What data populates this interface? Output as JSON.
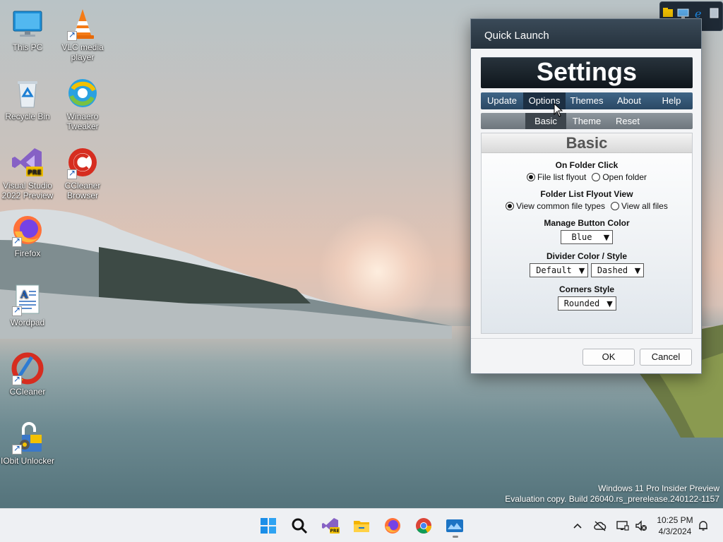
{
  "desktop": {
    "icons": [
      {
        "label": "This PC",
        "icon": "computer-icon"
      },
      {
        "label": "VLC media player",
        "icon": "vlc-cone-icon"
      },
      {
        "label": "Recycle Bin",
        "icon": "recycle-bin-icon"
      },
      {
        "label": "Winaero Tweaker",
        "icon": "winaero-tweaker-icon"
      },
      {
        "label": "Visual Studio 2022 Preview",
        "icon": "visual-studio-icon",
        "badge": "PRE"
      },
      {
        "label": "CCleaner Browser",
        "icon": "ccleaner-browser-icon"
      },
      {
        "label": "Firefox",
        "icon": "firefox-icon"
      },
      {
        "label": "Wordpad",
        "icon": "wordpad-icon"
      },
      {
        "label": "CCleaner",
        "icon": "ccleaner-icon"
      },
      {
        "label": "IObit Unlocker",
        "icon": "iobit-unlocker-icon"
      }
    ]
  },
  "watermark": {
    "line1": "Windows 11 Pro Insider Preview",
    "line2": "Evaluation copy. Build 26040.rs_prerelease.240122-1157"
  },
  "dialog": {
    "title": "Quick Launch",
    "banner": "Settings",
    "tabs": [
      "Update",
      "Options",
      "Themes",
      "About",
      "Help"
    ],
    "active_tab": "Options",
    "subtabs": [
      "Basic",
      "Theme",
      "Reset"
    ],
    "active_subtab": "Basic",
    "panel_title": "Basic",
    "on_folder_click": {
      "title": "On Folder Click",
      "options": [
        "File list flyout",
        "Open folder"
      ],
      "selected": "File list flyout"
    },
    "folder_list_view": {
      "title": "Folder List Flyout View",
      "options": [
        "View common file types",
        "View all files"
      ],
      "selected": "View common file types"
    },
    "manage_button_color": {
      "title": "Manage Button Color",
      "value": "Blue"
    },
    "divider": {
      "title": "Divider Color / Style",
      "color_value": "Default",
      "style_value": "Dashed"
    },
    "corners": {
      "title": "Corners Style",
      "value": "Rounded"
    },
    "ok_label": "OK",
    "cancel_label": "Cancel"
  },
  "taskbar": {
    "apps": [
      "windows-start-icon",
      "search-icon",
      "visual-studio-preview-icon",
      "file-explorer-icon",
      "firefox-icon",
      "chrome-icon",
      "quick-launch-app-icon"
    ],
    "clock_time": "10:25 PM",
    "clock_date": "4/3/2024"
  },
  "colors": {
    "accent_tab": "#2a4864",
    "banner": "#0f161c",
    "taskbar": "#eef0f3"
  }
}
